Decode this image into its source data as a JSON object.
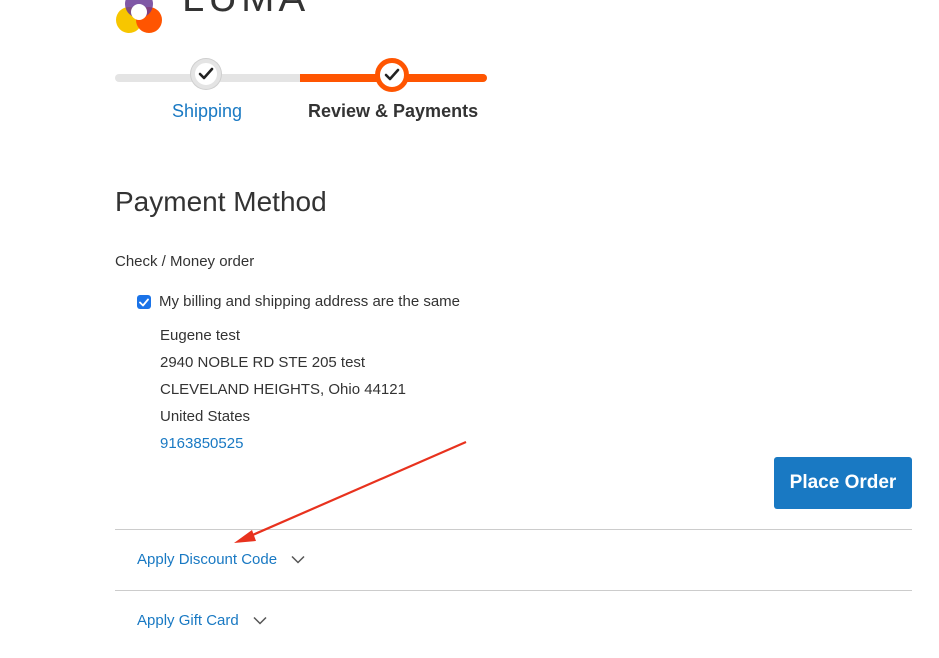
{
  "brand": {
    "name": "LUMA",
    "colors": {
      "accent": "#ff5501",
      "link": "#1979c3",
      "checkbox": "#1a73e8"
    }
  },
  "progress": {
    "steps": [
      {
        "label": "Shipping",
        "state": "complete"
      },
      {
        "label": "Review & Payments",
        "state": "active"
      }
    ]
  },
  "payment": {
    "title": "Payment Method",
    "method": "Check / Money order",
    "same_address_label": "My billing and shipping address are the same",
    "same_address_checked": true,
    "address": {
      "name": "Eugene test",
      "street": "2940 NOBLE RD STE 205 test",
      "city_line": "CLEVELAND HEIGHTS, Ohio 44121",
      "country": "United States",
      "phone": "9163850525"
    },
    "place_order_label": "Place Order"
  },
  "extras": {
    "discount_label": "Apply Discount Code",
    "gift_card_label": "Apply Gift Card"
  },
  "icons": {
    "logo": "luma-logo-icon",
    "step_check": "check-icon",
    "checkbox": "checkbox-checked-icon",
    "chevron": "chevron-down-icon",
    "annotation": "red-arrow-annotation"
  }
}
